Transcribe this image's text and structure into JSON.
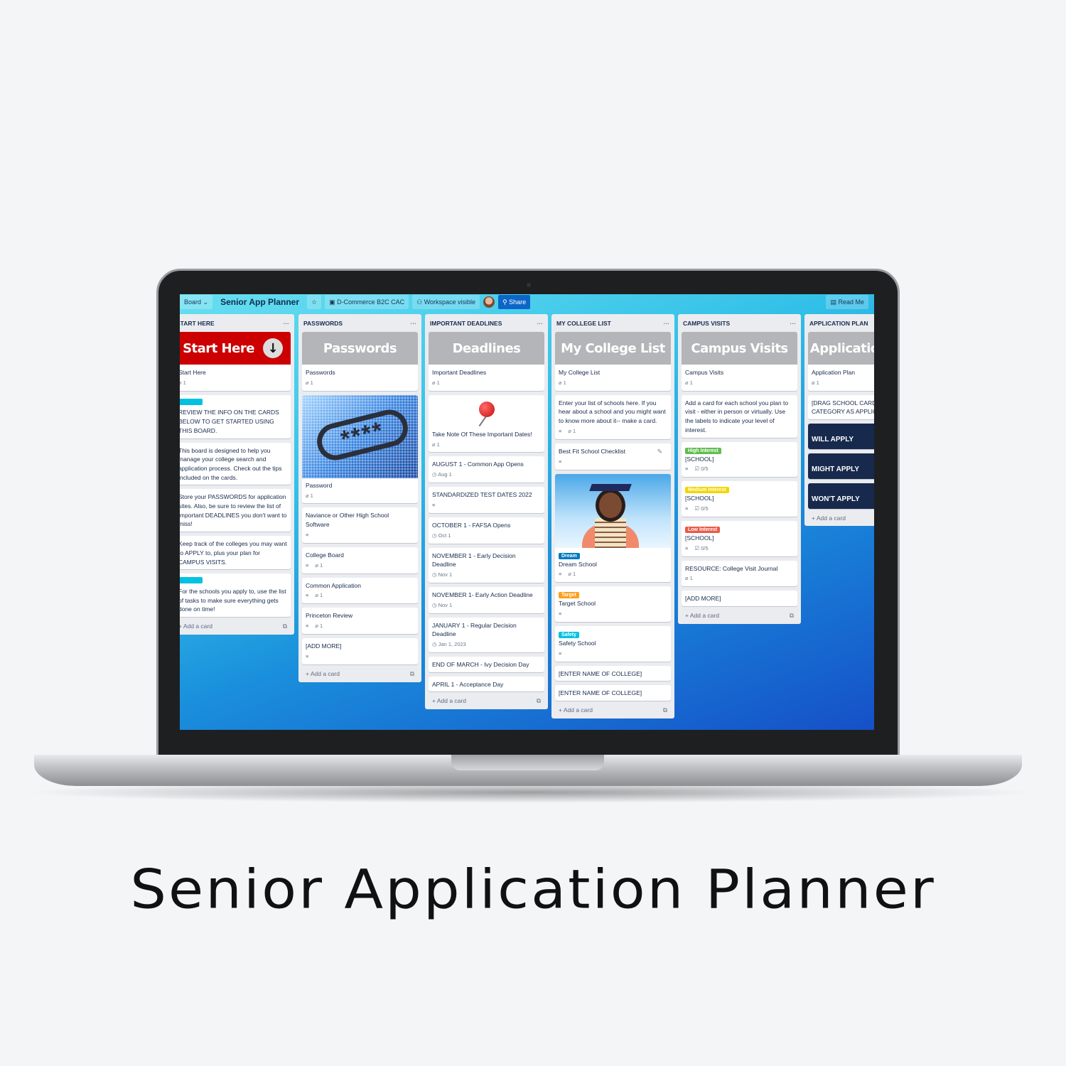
{
  "caption": "Senior Application Planner",
  "topbar": {
    "board_view": "Board",
    "board_title": "Senior App Planner",
    "star_icon": "star-icon",
    "workspace_name": "D-Commerce B2C CAC",
    "visibility": "Workspace visible",
    "share": "Share",
    "read_me": "Read Me"
  },
  "add_card": "+ Add a card",
  "colors": {
    "label_cyan": "#00c2e0",
    "high": "#61bd4f",
    "medium": "#f2d600",
    "low": "#eb5a46",
    "dream": "#0079bf",
    "target": "#ff9f1a",
    "safety": "#00c2e0",
    "start_cover": "#cc0000",
    "gray_cover": "#b3b5b8",
    "dark_card": "#172a4d"
  },
  "columns": [
    {
      "title": "START HERE",
      "cover": "Start Here",
      "cover_color": "#cc0000",
      "cover_icon": "arrow-down-circle-icon",
      "cards": [
        {
          "text": "Start Here",
          "attach": "1"
        },
        {
          "label": {
            "text": "",
            "color": "#00c2e0"
          },
          "text": "REVIEW THE INFO ON THE CARDS BELOW TO GET STARTED USING THIS BOARD."
        },
        {
          "text": "This board is designed to help you manage your college search and application process. Check out the tips included on the cards."
        },
        {
          "text": "Store your PASSWORDS for application sites. Also, be sure to review the list of important DEADLINES you don't want to miss!"
        },
        {
          "text": "Keep track of the colleges you may want to APPLY to, plus your plan for CAMPUS VISITS."
        },
        {
          "label": {
            "text": "",
            "color": "#00c2e0"
          },
          "text": "For the schools you apply to, use the list of tasks to make sure everything gets done on time!"
        }
      ]
    },
    {
      "title": "PASSWORDS",
      "cover": "Passwords",
      "cover_color": "#b3b5b8",
      "cards": [
        {
          "text": "Passwords",
          "attach": "1"
        },
        {
          "image": "password",
          "text": "Password",
          "attach": "1"
        },
        {
          "text": "Naviance or Other High School Software",
          "desc": true
        },
        {
          "text": "College Board",
          "desc": true,
          "attach": "1"
        },
        {
          "text": "Common Application",
          "desc": true,
          "attach": "1"
        },
        {
          "text": "Princeton Review",
          "desc": true,
          "attach": "1"
        },
        {
          "text": "[ADD MORE]",
          "desc": true
        }
      ]
    },
    {
      "title": "IMPORTANT DEADLINES",
      "cover": "Deadlines",
      "cover_color": "#b3b5b8",
      "cards": [
        {
          "text": "Important Deadlines",
          "attach": "1"
        },
        {
          "image": "pushpin",
          "text": "Take Note Of These Important Dates!",
          "attach": "1"
        },
        {
          "text": "AUGUST 1 - Common App Opens",
          "due": "Aug 1"
        },
        {
          "text": "STANDARDIZED TEST DATES 2022",
          "desc": true
        },
        {
          "text": "OCTOBER 1 - FAFSA Opens",
          "due": "Oct 1"
        },
        {
          "text": "NOVEMBER 1 - Early Decision Deadline",
          "due": "Nov 1"
        },
        {
          "text": "NOVEMBER 1- Early Action Deadline",
          "due": "Nov 1"
        },
        {
          "text": "JANUARY 1 - Regular Decision Deadline",
          "due": "Jan 1, 2023"
        },
        {
          "text": "END OF MARCH - Ivy Decision Day"
        },
        {
          "text": "APRIL 1 - Acceptance Day"
        }
      ]
    },
    {
      "title": "MY COLLEGE LIST",
      "cover": "My College List",
      "cover_color": "#b3b5b8",
      "cards": [
        {
          "text": "My College List",
          "attach": "1"
        },
        {
          "text": "Enter your list of schools here. If you hear about a school and you might want to know more about it-- make a card.",
          "desc": true,
          "attach": "1"
        },
        {
          "text": "Best Fit School Checklist",
          "desc": true,
          "edit": true
        },
        {
          "image": "graduate",
          "label": {
            "text": "Dream",
            "color": "#0079bf"
          },
          "text": "Dream School",
          "desc": true,
          "attach": "1"
        },
        {
          "label": {
            "text": "Target",
            "color": "#ff9f1a"
          },
          "text": "Target School",
          "desc": true
        },
        {
          "label": {
            "text": "Safety",
            "color": "#00c2e0"
          },
          "text": "Safety School",
          "desc": true
        },
        {
          "text": "[ENTER NAME OF COLLEGE]"
        },
        {
          "text": "[ENTER NAME OF COLLEGE]"
        }
      ]
    },
    {
      "title": "CAMPUS VISITS",
      "cover": "Campus Visits",
      "cover_color": "#b3b5b8",
      "cards": [
        {
          "text": "Campus Visits",
          "attach": "1"
        },
        {
          "text": "Add a card for each school you plan to visit - either in person or virtually. Use the labels to indicate your level of interest."
        },
        {
          "label": {
            "text": "High Interest",
            "color": "#61bd4f"
          },
          "text": "[SCHOOL]",
          "desc": true,
          "check": "0/5"
        },
        {
          "label": {
            "text": "Medium Interest",
            "color": "#f2d600"
          },
          "text": "[SCHOOL]",
          "desc": true,
          "check": "0/5"
        },
        {
          "label": {
            "text": "Low Interest",
            "color": "#eb5a46"
          },
          "text": "[SCHOOL]",
          "desc": true,
          "check": "0/5"
        },
        {
          "text": "RESOURCE: College Visit Journal",
          "attach": "1"
        },
        {
          "text": "[ADD MORE]"
        }
      ]
    },
    {
      "title": "APPLICATION PLAN",
      "cover": "Application Plan",
      "cover_color": "#b3b5b8",
      "cards": [
        {
          "text": "Application Plan",
          "attach": "1"
        },
        {
          "text": "[DRAG SCHOOL CARDS TO CATEGORY AS APPLICABLE]"
        },
        {
          "dark": true,
          "text": "WILL APPLY"
        },
        {
          "dark": true,
          "text": "MIGHT APPLY"
        },
        {
          "dark": true,
          "text": "WON'T APPLY"
        }
      ]
    }
  ]
}
